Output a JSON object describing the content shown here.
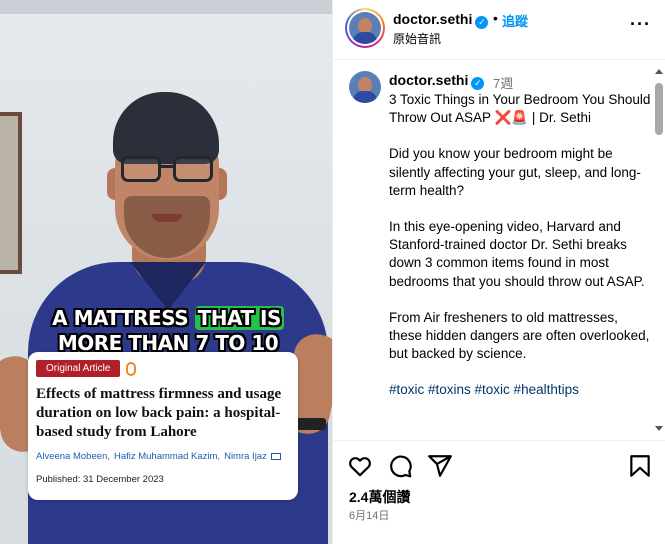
{
  "video": {
    "caption_line1_pre": "A MATTRESS ",
    "caption_line1_hl": "THAT IS",
    "caption_line2": "MORE THAN 7 TO 10",
    "article": {
      "badge": "Original Article",
      "title": "Effects of mattress firmness and usage duration on low back pain: a hospital-based study from Lahore",
      "authors": [
        "Alveena Mobeen,",
        "Hafiz Muhammad Kazim,",
        "Nimra Ijaz"
      ],
      "published": "Published: 31 December 2023"
    }
  },
  "header": {
    "username": "doctor.sethi",
    "verified_mark": "✓",
    "separator": "•",
    "follow_label": "追蹤",
    "audio_label": "原始音訊",
    "more_label": "···"
  },
  "comment": {
    "username": "doctor.sethi",
    "verified_mark": "✓",
    "time": "7週",
    "paragraphs": [
      "3 Toxic Things in Your Bedroom You Should Throw Out ASAP ❌🚨 | Dr. Sethi",
      "Did you know your bedroom might be silently affecting your gut, sleep, and long-term health?",
      "In this eye-opening video, Harvard and Stanford-trained doctor Dr. Sethi breaks down 3 common items found in most bedrooms that you should throw out ASAP.",
      "From Air fresheners to old mattresses, these hidden dangers are often overlooked, but backed by science."
    ],
    "hashtags": "#toxic #toxins #toxic #healthtips"
  },
  "footer": {
    "likes": "2.4萬個讚",
    "date": "6月14日"
  },
  "colors": {
    "accent": "#0095f6",
    "caption_highlight": "#24c24a",
    "badge": "#b1202a",
    "hashtag": "#00376b"
  },
  "icons": [
    "heart-icon",
    "comment-icon",
    "share-icon",
    "bookmark-icon",
    "more-icon",
    "verified-icon"
  ]
}
